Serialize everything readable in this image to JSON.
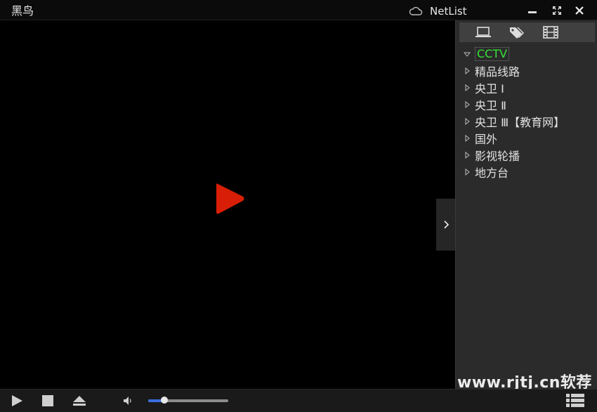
{
  "window": {
    "title": "黑鸟",
    "netlist_label": "NetList",
    "minimize_icon": "minimize-icon",
    "fullscreen_icon": "fullscreen-icon",
    "close_icon": "close-icon"
  },
  "player": {
    "play_icon": "play-icon",
    "side_toggle_icon": "chevron-right-icon",
    "accent_color": "#d81e06"
  },
  "panel": {
    "tabs": [
      {
        "icon": "laptop-icon"
      },
      {
        "icon": "tags-icon"
      },
      {
        "icon": "film-icon"
      }
    ],
    "items": [
      {
        "label": "CCTV",
        "expanded": true
      },
      {
        "label": "精品线路",
        "expanded": false
      },
      {
        "label": "央卫 Ⅰ",
        "expanded": false
      },
      {
        "label": "央卫 Ⅱ",
        "expanded": false
      },
      {
        "label": "央卫 Ⅲ【教育网】",
        "expanded": false
      },
      {
        "label": "国外",
        "expanded": false
      },
      {
        "label": "影视轮播",
        "expanded": false
      },
      {
        "label": "地方台",
        "expanded": false
      }
    ]
  },
  "controls": {
    "volume_level": 0.2,
    "volume_color": "#3a6fe0"
  },
  "watermark": "www.rjtj.cn软荐网"
}
